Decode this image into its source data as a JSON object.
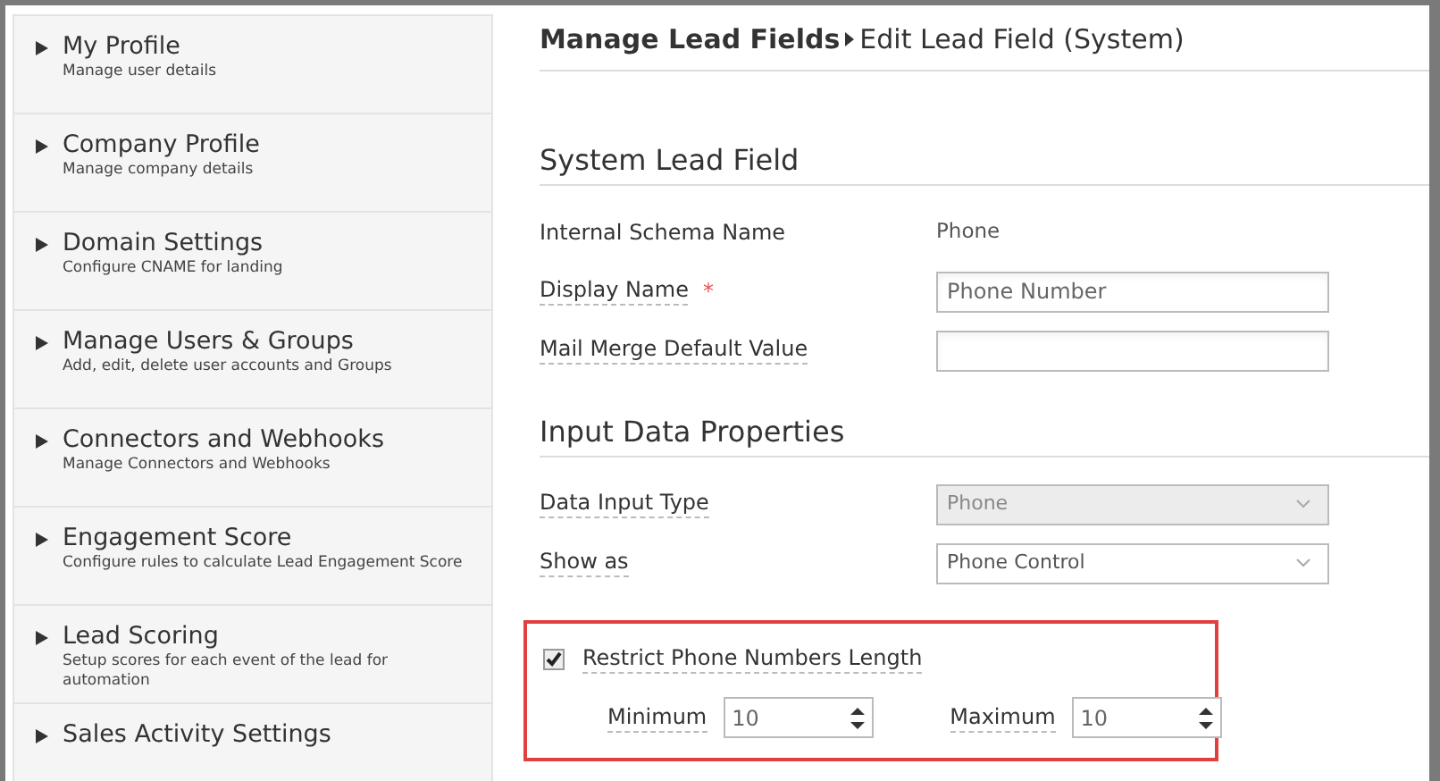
{
  "sidebar": {
    "items": [
      {
        "title": "My Profile",
        "subtitle": "Manage user details"
      },
      {
        "title": "Company Profile",
        "subtitle": "Manage company details"
      },
      {
        "title": "Domain Settings",
        "subtitle": "Configure CNAME for landing"
      },
      {
        "title": "Manage Users & Groups",
        "subtitle": "Add, edit, delete user accounts and Groups"
      },
      {
        "title": "Connectors and Webhooks",
        "subtitle": "Manage Connectors and Webhooks"
      },
      {
        "title": "Engagement Score",
        "subtitle": "Configure rules to calculate Lead Engagement Score"
      },
      {
        "title": "Lead Scoring",
        "subtitle": "Setup scores for each event of the lead for automation"
      },
      {
        "title": "Sales Activity Settings"
      }
    ]
  },
  "header": {
    "parent": "Manage Lead Fields",
    "current": "Edit Lead Field (System)"
  },
  "sections": [
    {
      "title": "System Lead Field",
      "rows": [
        {
          "kind": "text",
          "label": "Internal Schema Name",
          "value": "Phone"
        },
        {
          "kind": "input",
          "label": "Display Name",
          "required_mark": "*",
          "value": "Phone Number"
        },
        {
          "kind": "input",
          "label": "Mail Merge Default Value"
        }
      ]
    },
    {
      "title": "Input Data Properties",
      "rows": [
        {
          "kind": "select",
          "label": "Data Input Type",
          "value": "Phone",
          "disabled": true
        },
        {
          "kind": "select",
          "label": "Show as",
          "value": "Phone Control",
          "disabled": false
        }
      ]
    }
  ],
  "restrict": {
    "checked": true,
    "label": "Restrict Phone Numbers Length",
    "limits": [
      {
        "label": "Minimum",
        "value": "10"
      },
      {
        "label": "Maximum",
        "value": "10"
      }
    ]
  }
}
